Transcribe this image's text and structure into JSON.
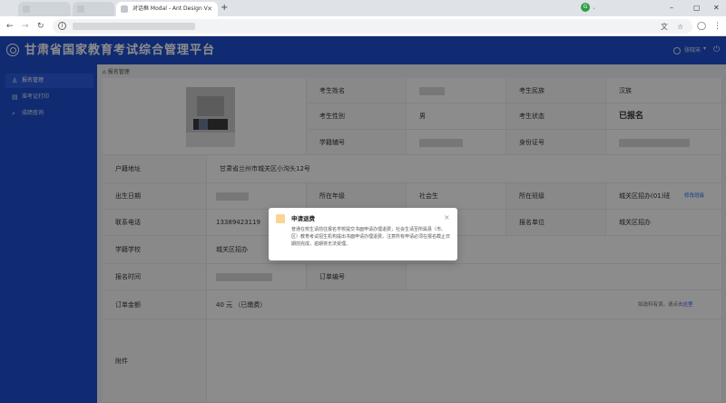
{
  "browser": {
    "active_tab_title": "对话框 Modal - Ant Design V",
    "new_tab": "+",
    "minimize": "–",
    "maximize": "▢",
    "close": "✕"
  },
  "header": {
    "title": "甘肃省国家教育考试综合管理平台",
    "username": "张晓宋"
  },
  "sidebar": {
    "items": [
      {
        "label": "报名管理",
        "icon": "user-icon"
      },
      {
        "label": "准考证打印",
        "icon": "print-icon"
      },
      {
        "label": "成绩查询",
        "icon": "search-icon"
      }
    ]
  },
  "breadcrumb": "报名管理",
  "form": {
    "name_label": "考生姓名",
    "ethnicity_label": "考生民族",
    "ethnicity_value": "汉族",
    "gender_label": "考生性别",
    "gender_value": "男",
    "status_label": "考生状态",
    "status_value": "已报名",
    "student_no_label": "学籍辅号",
    "id_label": "身份证号",
    "household_label": "户籍地址",
    "household_value": "甘肃省兰州市城关区小沟头12号",
    "birth_label": "出生日期",
    "grade_label": "所在年级",
    "grade_value": "社会生",
    "class_label": "所在班级",
    "class_value": "城关区招办(01)班",
    "class_edit": "修改班级",
    "phone_label": "联系电话",
    "phone_value": "13389423119",
    "unit_label": "报名单位",
    "unit_value": "城关区招办",
    "school_label": "学籍学校",
    "school_value": "城关区招办",
    "reg_time_label": "报名时间",
    "order_no_label": "订单编号",
    "amount_label": "订单金额",
    "amount_value": "40 元 （已缴费）",
    "note_text": "如选科有误，请点击",
    "note_link": "这里",
    "attachment_label": "附件"
  },
  "modal": {
    "title": "申请退费",
    "body": "普通在校生请前往报名学校提交书面申请办理退费，社会生请至所属县（市、区）教育考试招生机构提出书面申请办理退费。注意所有申请必须在报名截止日期前完成，逾期将无法受理。",
    "close": "×"
  }
}
